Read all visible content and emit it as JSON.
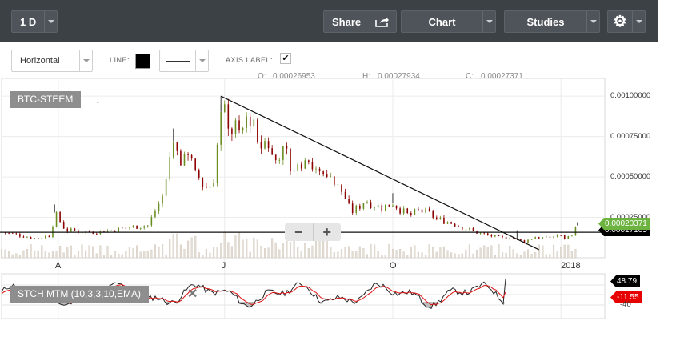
{
  "toolbar": {
    "interval": "1 D",
    "share": "Share",
    "chart": "Chart",
    "studies": "Studies"
  },
  "drawing": {
    "tool": "Horizontal",
    "line_label": "LINE:",
    "axis_label": "AXIS LABEL:",
    "axis_checked": "✔",
    "line_color": "#000000"
  },
  "ohlc": {
    "o_label": "O:",
    "o": "0.00026953",
    "h_label": "H:",
    "h": "0.00027934",
    "c_label": "C:",
    "c": "0.00027371"
  },
  "symbol": "BTC-STEEM",
  "study_label": "STCH MTM (10,3,3,10,EMA)",
  "price_tag": "0.00020371",
  "price_tag_hidden": "0.00017105",
  "study_tags": {
    "upper": "48.79",
    "lower": "-11.55",
    "level": "-40"
  },
  "colors": {
    "up": "#6b8e23",
    "down": "#8b0000",
    "candle_body": "#d8cfc0",
    "accent_green": "#6cb33f",
    "accent_red": "#e60000"
  },
  "chart_data": {
    "type": "candlestick",
    "y_axis": {
      "ticks": [
        "0.00100000",
        "0.00075000",
        "0.00050000",
        "0.00025000"
      ],
      "tick_values": [
        0.001,
        0.00075,
        0.0005,
        0.00025
      ],
      "ylim": [
        0.0,
        0.00109
      ]
    },
    "x_axis": {
      "ticks": [
        "A",
        "J",
        "O",
        "2018"
      ],
      "range": [
        "2017-03-01",
        "2018-01-25"
      ],
      "tick_dates": [
        "2017-04-01",
        "2017-07-01",
        "2017-10-01",
        "2018-01-01"
      ]
    },
    "close_series": [
      [
        "2017-03-01",
        0.00016
      ],
      [
        "2017-03-20",
        0.00012
      ],
      [
        "2017-03-28",
        0.00014
      ],
      [
        "2017-03-30",
        0.00028
      ],
      [
        "2017-04-05",
        0.00017
      ],
      [
        "2017-04-20",
        0.00016
      ],
      [
        "2017-05-01",
        0.00017
      ],
      [
        "2017-05-10",
        0.00019
      ],
      [
        "2017-05-20",
        0.0002
      ],
      [
        "2017-05-28",
        0.00038
      ],
      [
        "2017-06-03",
        0.00072
      ],
      [
        "2017-06-08",
        0.00058
      ],
      [
        "2017-06-12",
        0.00063
      ],
      [
        "2017-06-16",
        0.00052
      ],
      [
        "2017-06-20",
        0.00043
      ],
      [
        "2017-06-23",
        0.00045
      ],
      [
        "2017-06-26",
        0.00052
      ],
      [
        "2017-06-28",
        0.00087
      ],
      [
        "2017-07-01",
        0.00097
      ],
      [
        "2017-07-04",
        0.00078
      ],
      [
        "2017-07-08",
        0.00085
      ],
      [
        "2017-07-12",
        0.00082
      ],
      [
        "2017-07-16",
        0.00084
      ],
      [
        "2017-07-20",
        0.00075
      ],
      [
        "2017-07-25",
        0.00068
      ],
      [
        "2017-07-30",
        0.00066
      ],
      [
        "2017-08-04",
        0.00062
      ],
      [
        "2017-08-08",
        0.00055
      ],
      [
        "2017-08-12",
        0.00057
      ],
      [
        "2017-08-16",
        0.00063
      ],
      [
        "2017-08-20",
        0.00055
      ],
      [
        "2017-08-25",
        0.00052
      ],
      [
        "2017-08-30",
        0.00046
      ],
      [
        "2017-09-04",
        0.0004
      ],
      [
        "2017-09-08",
        0.00028
      ],
      [
        "2017-09-12",
        0.00031
      ],
      [
        "2017-09-16",
        0.00036
      ],
      [
        "2017-09-20",
        0.00033
      ],
      [
        "2017-09-25",
        0.00031
      ],
      [
        "2017-10-01",
        0.00034
      ],
      [
        "2017-10-06",
        0.00029
      ],
      [
        "2017-10-10",
        0.00026
      ],
      [
        "2017-10-15",
        0.00029
      ],
      [
        "2017-10-20",
        0.00028
      ],
      [
        "2017-10-25",
        0.00024
      ],
      [
        "2017-11-01",
        0.00022
      ],
      [
        "2017-11-08",
        0.00019
      ],
      [
        "2017-11-15",
        0.00016
      ],
      [
        "2017-11-22",
        0.00014
      ],
      [
        "2017-11-29",
        0.00012
      ],
      [
        "2017-12-04",
        0.00013
      ],
      [
        "2017-12-08",
        0.00011
      ],
      [
        "2017-12-12",
        0.0001
      ],
      [
        "2017-12-18",
        0.00013
      ],
      [
        "2017-12-24",
        0.00012
      ],
      [
        "2017-12-30",
        0.00014
      ],
      [
        "2018-01-04",
        0.00012
      ],
      [
        "2018-01-08",
        0.00016
      ],
      [
        "2018-01-10",
        0.0002
      ]
    ],
    "high_spikes": [
      [
        "2017-03-30",
        0.00033
      ],
      [
        "2017-06-03",
        0.0008
      ],
      [
        "2017-06-29",
        0.001
      ],
      [
        "2017-10-01",
        0.0004
      ],
      [
        "2017-12-08",
        0.00017
      ],
      [
        "2018-01-10",
        0.00022
      ]
    ],
    "trendline": [
      [
        "2017-06-29",
        0.001
      ],
      [
        "2017-12-20",
        5e-05
      ]
    ],
    "horizontal_line": 0.000158
  }
}
